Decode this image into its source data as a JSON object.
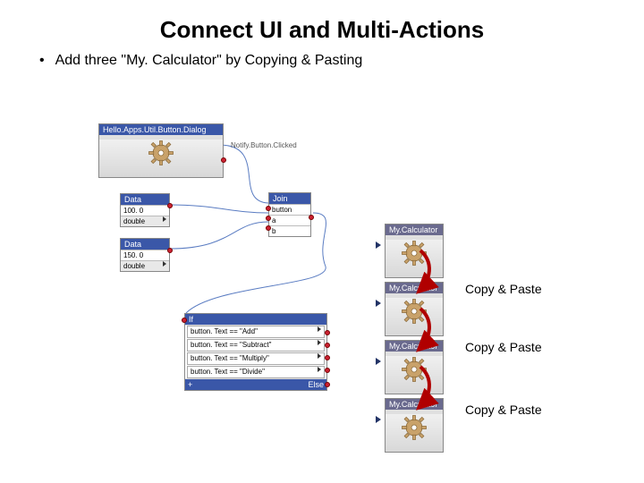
{
  "title": "Connect UI and Multi-Actions",
  "bullet": "Add three \"My. Calculator\" by Copying & Pasting",
  "nodes": {
    "dialog": {
      "label": "Hello.Apps.Util.Button.Dialog"
    },
    "notify": "Notify.Button.Clicked",
    "data1": {
      "hdr": "Data",
      "val": "100. 0",
      "type": "double"
    },
    "data2": {
      "hdr": "Data",
      "val": "150. 0",
      "type": "double"
    },
    "join": {
      "hdr": "Join",
      "rows": [
        "button",
        "a",
        "b"
      ]
    },
    "if": {
      "hdr": "If",
      "rows": [
        "button. Text == \"Add\"",
        "button. Text == \"Subtract\"",
        "button. Text == \"Multiply\"",
        "button. Text == \"Divide\""
      ],
      "plus": "+",
      "else": "Else"
    },
    "calc": {
      "label": "My.Calculator"
    }
  },
  "copy_paste": "Copy & Paste"
}
